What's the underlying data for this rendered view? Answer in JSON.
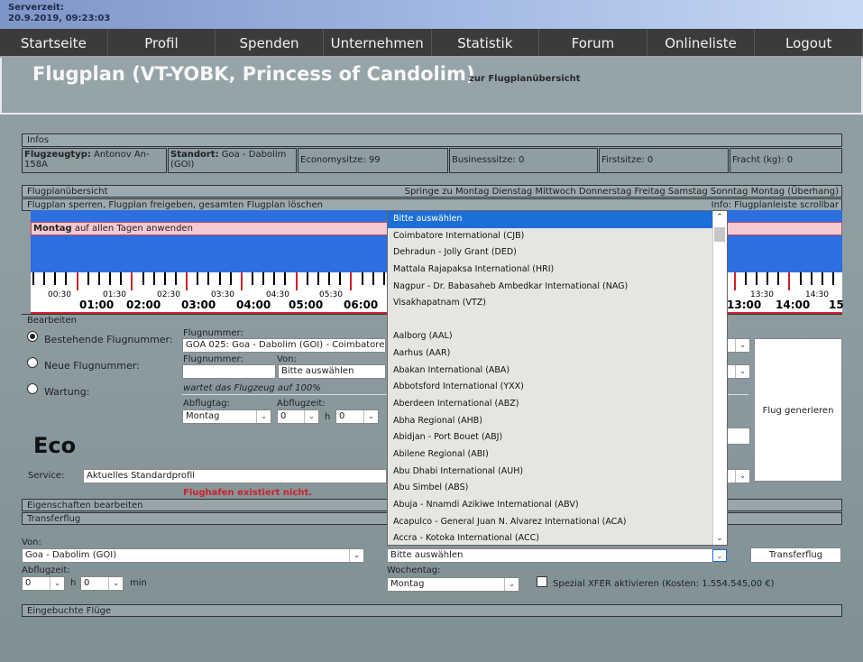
{
  "server": {
    "label": "Serverzeit:",
    "time": "20.9.2019, 09:23:03"
  },
  "nav": [
    "Startseite",
    "Profil",
    "Spenden",
    "Unternehmen",
    "Statistik",
    "Forum",
    "Onlineliste",
    "Logout"
  ],
  "header": {
    "title": "Flugplan (VT-YOBK, Princess of Candolim)",
    "subtitle": "zur Flugplanübersicht"
  },
  "infos": {
    "title": "Infos",
    "type_label": "Flugzeugtyp:",
    "type_value": "Antonov An-158A",
    "standort_label": "Standort:",
    "standort_value": "Goa - Dabolim (GOI)",
    "economy": "Economysitze: 99",
    "business": "Businesssitze: 0",
    "first": "Firstsitze: 0",
    "fracht": "Fracht (kg): 0"
  },
  "overview": {
    "title": "Flugplanübersicht",
    "jump": "Springe zu Montag Dienstag Mittwoch Donnerstag Freitag Samstag Sonntag Montag (Überhang)",
    "actions": "Flugplan sperren, Flugplan freigeben, gesamten Flugplan löschen",
    "info": "Info: Flugplanleiste scrollbar",
    "apply_day": "Montag",
    "apply_text": "auf allen Tagen anwenden",
    "hours": [
      "01:00",
      "02:00",
      "03:00",
      "04:00",
      "05:00",
      "06:00",
      "13:00",
      "14:00",
      "15"
    ],
    "half_hours": [
      "00:30",
      "01:30",
      "02:30",
      "03:30",
      "04:30",
      "05:30",
      "13:30",
      "14:30"
    ]
  },
  "edit": {
    "title": "Bearbeiten",
    "opt_existing": "Bestehende Flugnummer:",
    "opt_new": "Neue Flugnummer:",
    "opt_maint": "Wartung:",
    "flugnummer_label": "Flugnummer:",
    "flugnummer_value": "GOA 025: Goa - Dabolim (GOI) - Coimbatore Inte",
    "flugnummer2_label": "Flugnummer:",
    "von_label": "Von:",
    "von_value": "Bitte auswählen",
    "maint_note": "wartet das Flugzeug auf 100%",
    "abflugtag_label": "Abflugtag:",
    "abflugtag_value": "Montag",
    "abflugzeit_label": "Abflugzeit:",
    "h_value": "0",
    "min_value": "0",
    "h_label": "h",
    "generate": "Flug generieren"
  },
  "eco": {
    "label": "Eco",
    "service_label": "Service:",
    "service_value": "Aktuelles Standardprofil",
    "error": "Flughafen existiert nicht."
  },
  "eigenschaften": "Eigenschaften bearbeiten",
  "transfer": {
    "title": "Transferflug",
    "von_label": "Von:",
    "von_value": "Goa - Dabolim (GOI)",
    "nach_value": "Bitte auswählen",
    "button": "Transferflug",
    "abflugzeit_label": "Abflugzeit:",
    "h_value": "0",
    "min_value": "0",
    "h_label": "h",
    "min_label": "min",
    "wochentag_label": "Wochentag:",
    "wochentag_value": "Montag",
    "spezial": "Spezial XFER aktivieren (Kosten: 1.554.545,00 €)"
  },
  "eingebucht": "Eingebuchte Flüge",
  "dropdown": [
    "Bitte auswählen",
    "Coimbatore International (CJB)",
    "Dehradun - Jolly Grant (DED)",
    "Mattala Rajapaksa International (HRI)",
    "Nagpur - Dr. Babasaheb Ambedkar International (NAG)",
    "Visakhapatnam (VTZ)",
    "",
    "Aalborg (AAL)",
    "Aarhus (AAR)",
    "Abakan International (ABA)",
    "Abbotsford International (YXX)",
    "Aberdeen International (ABZ)",
    "Abha Regional (AHB)",
    "Abidjan - Port Bouet (ABJ)",
    "Abilene Regional (ABI)",
    "Abu Dhabi International (AUH)",
    "Abu Simbel (ABS)",
    "Abuja - Nnamdi Azikiwe International (ABV)",
    "Acapulco - General Juan N. Alvarez International (ACA)",
    "Accra - Kotoka International (ACC)"
  ]
}
